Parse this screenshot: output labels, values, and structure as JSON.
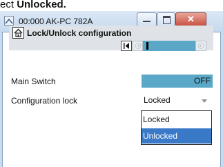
{
  "caption": {
    "prefix": "ect ",
    "bold": "Unlocked."
  },
  "window": {
    "title": "00:000 AK-PC 782A",
    "buttons": {
      "minimize": "minimize-icon",
      "maximize": "maximize-icon",
      "close": "✕"
    }
  },
  "header": {
    "title": "Lock/Unlock configuration",
    "home_icon": "home-icon",
    "nav": [
      "first-page-icon",
      "prev-page-icon",
      "page-indicator",
      "next-page-icon"
    ]
  },
  "rows": [
    {
      "label": "Main Switch",
      "value": "OFF"
    },
    {
      "label": "Configuration lock",
      "value": "Locked"
    }
  ],
  "dropdown": {
    "options": [
      "Locked",
      "Unlocked"
    ],
    "highlighted": "Unlocked"
  },
  "colors": {
    "accent": "#5aa7c7",
    "selection": "#3a79c8",
    "close": "#c75245"
  }
}
